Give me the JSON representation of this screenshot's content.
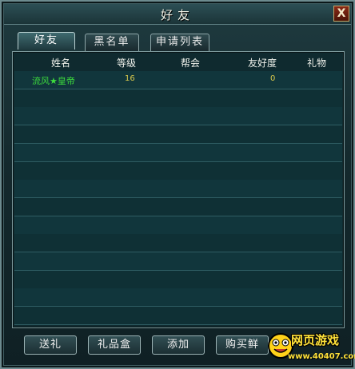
{
  "window": {
    "title": "好友",
    "close_label": "X"
  },
  "tabs": [
    {
      "label": "好友",
      "active": true
    },
    {
      "label": "黑名单",
      "active": false
    },
    {
      "label": "申请列表",
      "active": false
    }
  ],
  "columns": [
    "姓名",
    "等级",
    "帮会",
    "友好度",
    "礼物"
  ],
  "friends": [
    {
      "name": "流风★皇帝",
      "level": "16",
      "guild": "",
      "favor": "0",
      "gift": ""
    }
  ],
  "buttons": {
    "send_gift": "送礼",
    "gift_box": "礼品盒",
    "add": "添加",
    "buy": "购买鲜"
  },
  "watermark": {
    "title": "网页游戏",
    "url": "www.40407.com"
  },
  "colors": {
    "friend_name": "#3ddc3d",
    "numbers": "#d8c84c",
    "frame": "#6d8b8f"
  }
}
